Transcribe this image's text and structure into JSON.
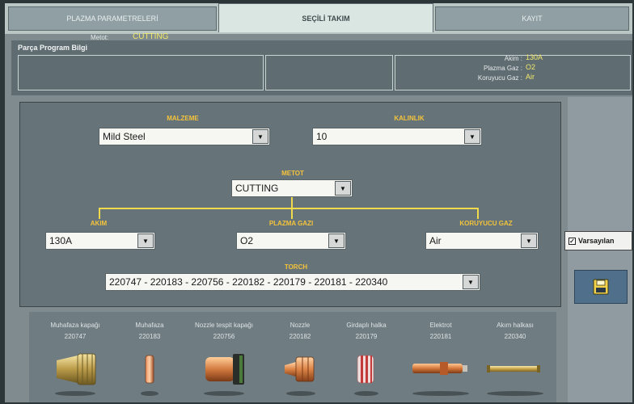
{
  "tabs": [
    {
      "label": "PLAZMA PARAMETRELERİ",
      "active": false
    },
    {
      "label": "SEÇİLİ TAKIM",
      "active": true
    },
    {
      "label": "KAYIT",
      "active": false
    }
  ],
  "info": {
    "title": "Parça Program Bilgi",
    "metot_label": "Metot:",
    "metot_value": "CUTTING",
    "akim_label": "Akim :",
    "akim_value": "130A",
    "plazma_gaz_label": "Plazma Gaz :",
    "plazma_gaz_value": "O2",
    "koruyucu_gaz_label": "Koruyucu Gaz :",
    "koruyucu_gaz_value": "Air"
  },
  "form": {
    "malzeme_label": "MALZEME",
    "malzeme_value": "Mild Steel",
    "kalinlik_label": "KALINLIK",
    "kalinlik_value": "10",
    "metot_label": "METOT",
    "metot_value": "CUTTING",
    "akim_label": "AKIM",
    "akim_value": "130A",
    "plazma_gazi_label": "PLAZMA GAZI",
    "plazma_gazi_value": "O2",
    "koruyucu_gaz_label": "KORUYUCU GAZ",
    "koruyucu_gaz_value": "Air",
    "torch_label": "TORCH",
    "torch_value": "220747 - 220183 - 220756 - 220182 - 220179 - 220181 - 220340"
  },
  "checkbox": {
    "label": "Varsayılan",
    "checked": true
  },
  "consumables": [
    {
      "name": "Muhafaza kapağı",
      "code": "220747",
      "icon": "shield-cap-icon"
    },
    {
      "name": "Muhafaza",
      "code": "220183",
      "icon": "shield-ring-icon"
    },
    {
      "name": "Nozzle tespit kapağı",
      "code": "220756",
      "icon": "retaining-cap-icon"
    },
    {
      "name": "Nozzle",
      "code": "220182",
      "icon": "nozzle-icon"
    },
    {
      "name": "Girdaplı halka",
      "code": "220179",
      "icon": "swirl-ring-icon"
    },
    {
      "name": "Elektrot",
      "code": "220181",
      "icon": "electrode-icon"
    },
    {
      "name": "Akım halkası",
      "code": "220340",
      "icon": "current-ring-icon"
    }
  ],
  "colors": {
    "label_accent": "#f4c33a",
    "value_accent": "#f2e96a",
    "connector": "#f0d94a"
  }
}
